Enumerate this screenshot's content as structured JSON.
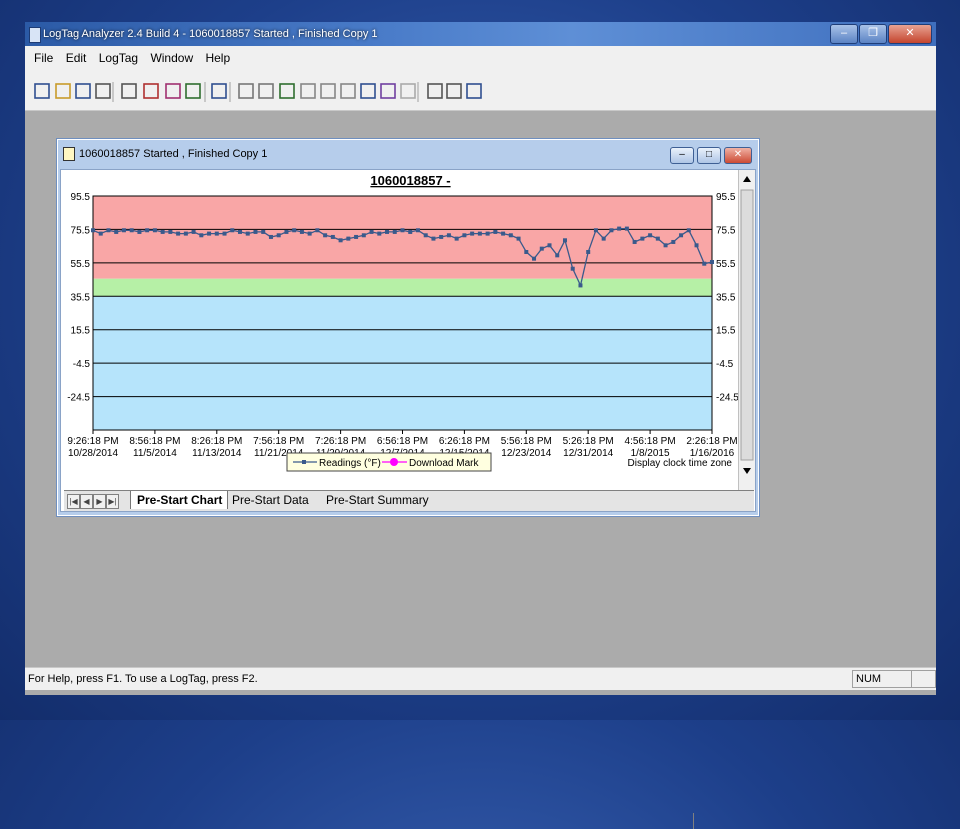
{
  "app": {
    "title": "LogTag Analyzer 2.4 Build 4 - 1060018857 Started , Finished Copy 1",
    "window_buttons": [
      "–",
      "❐",
      "✕"
    ]
  },
  "menu": [
    "File",
    "Edit",
    "LogTag",
    "Window",
    "Help"
  ],
  "toolbar": {
    "icons": [
      "new-file-icon",
      "open-folder-icon",
      "save-icon",
      "print-icon",
      "properties-icon",
      "download-icon",
      "filter-icon",
      "export-icon",
      "copy-icon",
      "zoom-icon",
      "table-view-icon",
      "report-icon",
      "chart-icon",
      "chart-icon",
      "chart-icon",
      "chart-icon",
      "chart-icon",
      "chart-icon",
      "tools-icon",
      "tag-icon",
      "help-pointer-icon"
    ]
  },
  "child_window": {
    "title": "1060018857 Started , Finished Copy 1",
    "buttons": [
      "–",
      "□",
      "✕"
    ]
  },
  "status": {
    "help_text": "For Help, press F1. To use a LogTag, press F2.",
    "num": "NUM"
  },
  "tabs": [
    "Pre-Start Chart",
    "Pre-Start Data",
    "Pre-Start Summary"
  ],
  "colors": {
    "alarm_high": "#f9a6a6",
    "ok_band": "#b6f0a6",
    "alarm_low": "#b6e4fb",
    "series": "#3a5a8c",
    "download_mark": "#ff00ff"
  },
  "chart_data": {
    "type": "line",
    "title": "1060018857 -",
    "xlabel": "",
    "ylabel": "",
    "ylim": [
      -44.5,
      95.5
    ],
    "yticks": [
      95.5,
      75.5,
      55.5,
      35.5,
      15.5,
      -4.5,
      -24.5
    ],
    "xlim": [
      "10/28/2014 9:26:18 PM",
      "1/16/2015 2:26:18 PM"
    ],
    "xticks": [
      [
        "9:26:18 PM",
        "10/28/2014"
      ],
      [
        "8:56:18 PM",
        "11/5/2014"
      ],
      [
        "8:26:18 PM",
        "11/13/2014"
      ],
      [
        "7:56:18 PM",
        "11/21/2014"
      ],
      [
        "7:26:18 PM",
        "11/29/2014"
      ],
      [
        "6:56:18 PM",
        "12/7/2014"
      ],
      [
        "6:26:18 PM",
        "12/15/2014"
      ],
      [
        "5:56:18 PM",
        "12/23/2014"
      ],
      [
        "5:26:18 PM",
        "12/31/2014"
      ],
      [
        "4:56:18 PM",
        "1/8/2015"
      ],
      [
        "2:26:18 PM",
        "1/16/2016"
      ]
    ],
    "bands": [
      {
        "from": 46,
        "to": 95.5,
        "color": "#f9a6a6"
      },
      {
        "from": 35.5,
        "to": 46,
        "color": "#b6f0a6"
      },
      {
        "from": -44.5,
        "to": 35.5,
        "color": "#b6e4fb"
      }
    ],
    "series": [
      {
        "name": "Readings (°F)",
        "x": [
          "10/28/2014",
          "10/29/2014",
          "10/30/2014",
          "10/31/2014",
          "11/1/2014",
          "11/2/2014",
          "11/3/2014",
          "11/4/2014",
          "11/5/2014",
          "11/6/2014",
          "11/7/2014",
          "11/8/2014",
          "11/9/2014",
          "11/10/2014",
          "11/11/2014",
          "11/12/2014",
          "11/13/2014",
          "11/14/2014",
          "11/15/2014",
          "11/16/2014",
          "11/17/2014",
          "11/18/2014",
          "11/19/2014",
          "11/20/2014",
          "11/21/2014",
          "11/22/2014",
          "11/23/2014",
          "11/24/2014",
          "11/25/2014",
          "11/26/2014",
          "11/27/2014",
          "11/28/2014",
          "11/29/2014",
          "11/30/2014",
          "12/1/2014",
          "12/2/2014",
          "12/3/2014",
          "12/4/2014",
          "12/5/2014",
          "12/6/2014",
          "12/7/2014",
          "12/8/2014",
          "12/9/2014",
          "12/10/2014",
          "12/11/2014",
          "12/12/2014",
          "12/13/2014",
          "12/14/2014",
          "12/15/2014",
          "12/16/2014",
          "12/17/2014",
          "12/18/2014",
          "12/19/2014",
          "12/20/2014",
          "12/21/2014",
          "12/22/2014",
          "12/23/2014",
          "12/24/2014",
          "12/25/2014",
          "12/26/2014",
          "12/27/2014",
          "12/28/2014",
          "12/29/2014",
          "12/30/2014",
          "12/31/2014",
          "1/1/2015",
          "1/2/2015",
          "1/3/2015",
          "1/4/2015",
          "1/5/2015",
          "1/6/2015",
          "1/7/2015",
          "1/8/2015",
          "1/9/2015",
          "1/10/2015",
          "1/11/2015",
          "1/12/2015",
          "1/13/2015",
          "1/14/2015",
          "1/15/2015",
          "1/16/2015"
        ],
        "y": [
          75,
          73,
          75,
          74,
          75,
          75,
          74,
          75,
          75,
          74,
          74,
          73,
          73,
          74,
          72,
          73,
          73,
          73,
          75,
          74,
          73,
          74,
          74,
          71,
          72,
          74,
          75,
          74,
          73,
          75,
          72,
          71,
          69,
          70,
          71,
          72,
          74,
          73,
          74,
          74,
          75,
          74,
          75,
          72,
          70,
          71,
          72,
          70,
          72,
          73,
          73,
          73,
          74,
          73,
          72,
          70,
          62,
          58,
          64,
          66,
          60,
          69,
          52,
          42,
          62,
          75,
          70,
          75,
          76,
          76,
          68,
          70,
          72,
          70,
          66,
          68,
          72,
          75,
          66,
          55,
          56
        ]
      },
      {
        "name": "Download Mark",
        "x": [],
        "y": []
      }
    ],
    "legend": {
      "position": "bottom-center",
      "entries": [
        "Readings (°F)",
        "Download Mark"
      ]
    },
    "annotation": "Display clock time zone",
    "grid": true,
    "right_axis_mirror": true
  }
}
